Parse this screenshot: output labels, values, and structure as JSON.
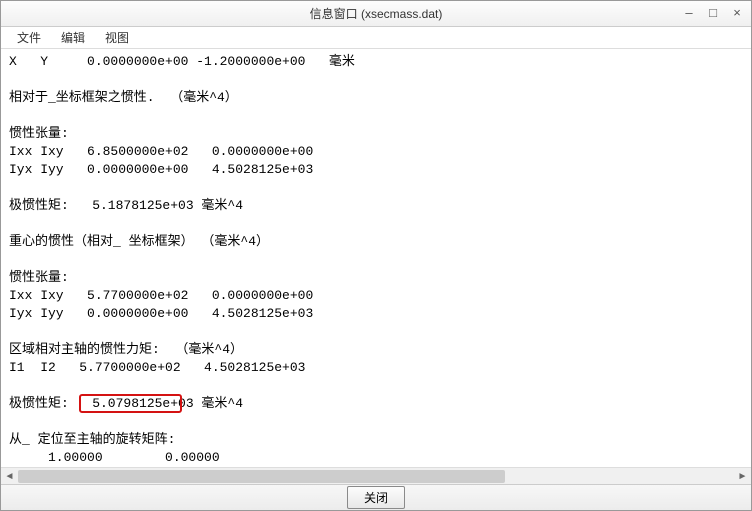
{
  "window": {
    "title": "信息窗口 (xsecmass.dat)",
    "minimize": "–",
    "maximize": "□",
    "close": "×"
  },
  "menu": {
    "file": "文件",
    "edit": "编辑",
    "view": "视图"
  },
  "content": {
    "line1": "X   Y     0.0000000e+00 -1.2000000e+00   毫米",
    "line2": "",
    "line3": "相对于_坐标框架之惯性.  （毫米^4）",
    "line4": "",
    "line5": "惯性张量:",
    "line6": "Ixx Ixy   6.8500000e+02   0.0000000e+00",
    "line7": "Iyx Iyy   0.0000000e+00   4.5028125e+03",
    "line8": "",
    "line9": "极惯性矩:   5.1878125e+03 毫米^4",
    "line10": "",
    "line11": "重心的惯性（相对_ 坐标框架） （毫米^4）",
    "line12": "",
    "line13": "惯性张量:",
    "line14": "Ixx Ixy   5.7700000e+02   0.0000000e+00",
    "line15": "Iyx Iyy   0.0000000e+00   4.5028125e+03",
    "line16": "",
    "line17": "区域相对主轴的惯性力矩:  （毫米^4）",
    "line18": "I1  I2   5.7700000e+02   4.5028125e+03",
    "line19": "",
    "line20": "极惯性矩:   5.0798125e+03 毫米^4",
    "line21": "",
    "line22": "从_ 定位至主轴的旋转矩阵:",
    "line23": "     1.00000        0.00000"
  },
  "scrollbar": {
    "left_arrow": "◄",
    "right_arrow": "►"
  },
  "footer": {
    "close_label": "关闭"
  }
}
